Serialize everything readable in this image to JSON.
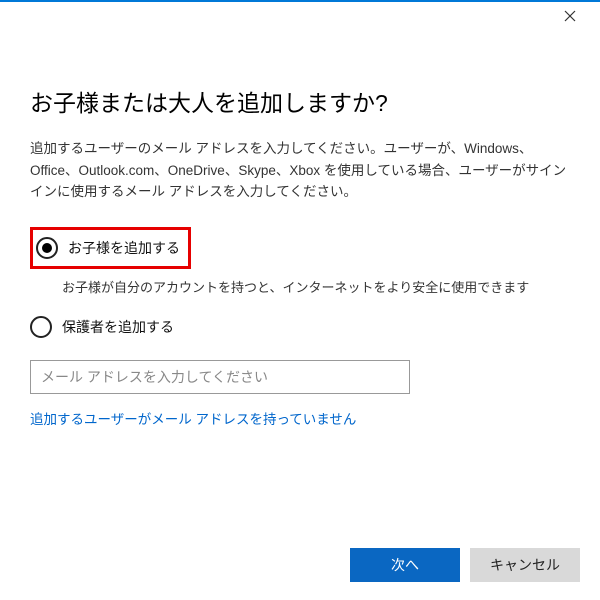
{
  "heading": "お子様または大人を追加しますか?",
  "description": "追加するユーザーのメール アドレスを入力してください。ユーザーが、Windows、Office、Outlook.com、OneDrive、Skype、Xbox を使用している場合、ユーザーがサインインに使用するメール アドレスを入力してください。",
  "options": {
    "child": {
      "label": "お子様を追加する",
      "hint": "お子様が自分のアカウントを持つと、インターネットをより安全に使用できます",
      "selected": true
    },
    "adult": {
      "label": "保護者を追加する",
      "selected": false
    }
  },
  "email": {
    "placeholder": "メール アドレスを入力してください",
    "value": ""
  },
  "link_no_email": "追加するユーザーがメール アドレスを持っていません",
  "buttons": {
    "next": "次へ",
    "cancel": "キャンセル"
  }
}
